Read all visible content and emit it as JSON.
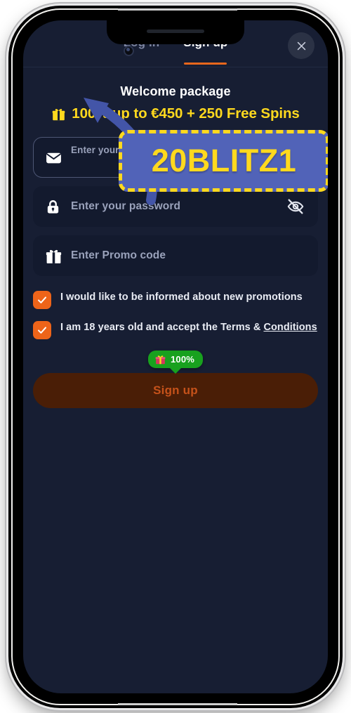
{
  "device": {
    "type": "smartphone-mockup",
    "notch_icons": [
      "speaker-grille",
      "front-camera"
    ]
  },
  "header": {
    "tabs": [
      {
        "label": "Log in",
        "active": false
      },
      {
        "label": "Sign up",
        "active": true
      }
    ],
    "close_label": "×",
    "close_icon": "close-icon",
    "active_underline_color": "#e8671c"
  },
  "promo": {
    "title": "Welcome package",
    "gift_icon": "gift-icon",
    "offer": "100% up to €450 + 250 Free Spins",
    "offer_color": "#ffd91e"
  },
  "form": {
    "fields": [
      {
        "name": "email",
        "icon": "envelope-icon",
        "placeholder": "Enter your email",
        "value": "",
        "outlined": true
      },
      {
        "name": "password",
        "icon": "lock-icon",
        "placeholder": "Enter your password",
        "value": "",
        "outlined": false,
        "trailing_icon": "eye-off-icon"
      },
      {
        "name": "promo",
        "icon": "gift-icon",
        "placeholder": "Enter Promo code",
        "value": "",
        "outlined": false
      }
    ]
  },
  "consents": [
    {
      "checked": true,
      "text": "I would like to be informed about new promotions",
      "link_text": ""
    },
    {
      "checked": true,
      "text": "I am 18 years old and accept the Terms & ",
      "link_text": "Conditions"
    }
  ],
  "bonus_badge": {
    "icon": "gift-present-icon",
    "text": "100%",
    "background": "#18a11e"
  },
  "submit": {
    "label": "Sign up",
    "background": "#4a1e06",
    "text_color": "#c5521a"
  },
  "annotation": {
    "promo_code": "20BLITZ1",
    "callout_fill": "#5163b8",
    "callout_border": "#ffd91e",
    "arrow_color": "#4355a8",
    "arrow_target": "promo-code-field"
  },
  "theme": {
    "screen_background": "#171e33",
    "field_background": "#131a2e",
    "checkbox_color": "#ee6419",
    "accent": "#e8671c"
  }
}
